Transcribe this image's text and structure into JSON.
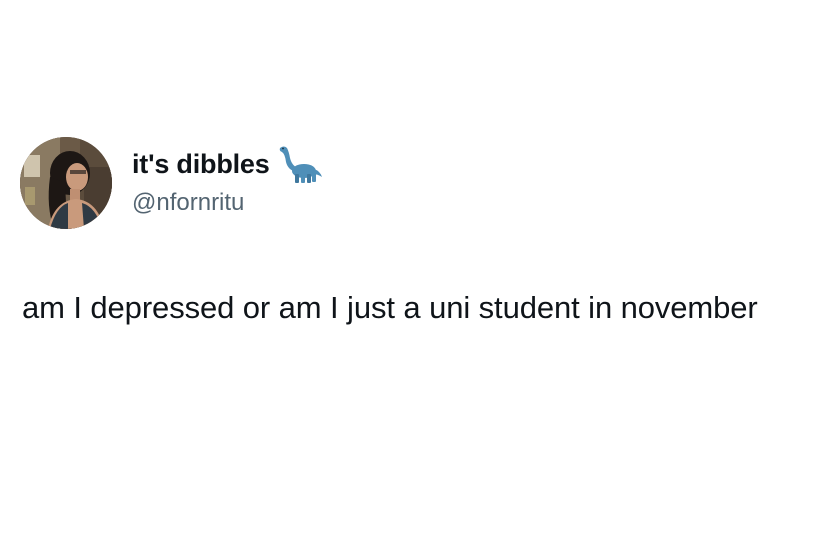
{
  "author": {
    "display_name": "it's dibbles",
    "handle": "@nfornritu",
    "avatar_icon": "profile-photo",
    "badge_icon": "sauropod-dinosaur-emoji"
  },
  "tweet": {
    "text": "am I depressed or am I just a uni student in november"
  },
  "colors": {
    "text_primary": "#0f1419",
    "text_secondary": "#536471",
    "background": "#ffffff",
    "emoji_dino": "#4f8fb8"
  }
}
